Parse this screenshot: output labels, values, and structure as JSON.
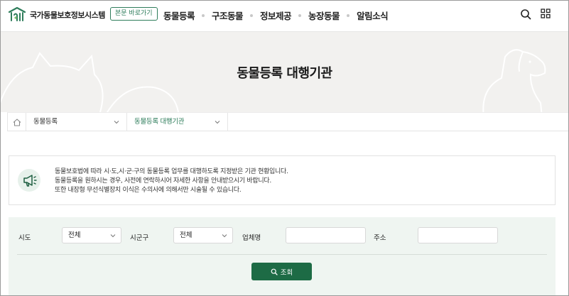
{
  "header": {
    "logo_text": "국가동물보호정보시스템",
    "skip_button": "본문 바로가기",
    "nav": [
      "동물등록",
      "구조동물",
      "정보제공",
      "농장동물",
      "알림소식"
    ],
    "search_icon": "search-icon",
    "menu_icon": "grid-menu-icon"
  },
  "hero": {
    "title": "동물등록 대행기관"
  },
  "breadcrumb": {
    "home_icon": "home-icon",
    "level1": "동물등록",
    "level2": "동물등록 대행기관"
  },
  "notice": {
    "icon": "megaphone-icon",
    "lines": [
      "동물보호법에 따라 시·도,시·군·구의 동물등록 업무를 대행하도록 지정받은 기관 현황입니다.",
      "동물등록을 원하시는 경우, 사전에 연락하시어 자세한 사항을 안내받으시기 바랍니다.",
      "또한 내장형 무선식별장치 이식은 수의사에 의해서만 시술될 수 있습니다."
    ]
  },
  "search": {
    "sido_label": "시도",
    "sido_value": "전체",
    "sigungu_label": "시군구",
    "sigungu_value": "전체",
    "company_label": "업체명",
    "company_value": "",
    "address_label": "주소",
    "address_value": "",
    "submit_label": "조회"
  },
  "colors": {
    "brand_green": "#1d6b45",
    "accent_green": "#2e7d5b",
    "search_panel_bg": "#eff5f1",
    "hero_bg": "#f2f1ef"
  }
}
